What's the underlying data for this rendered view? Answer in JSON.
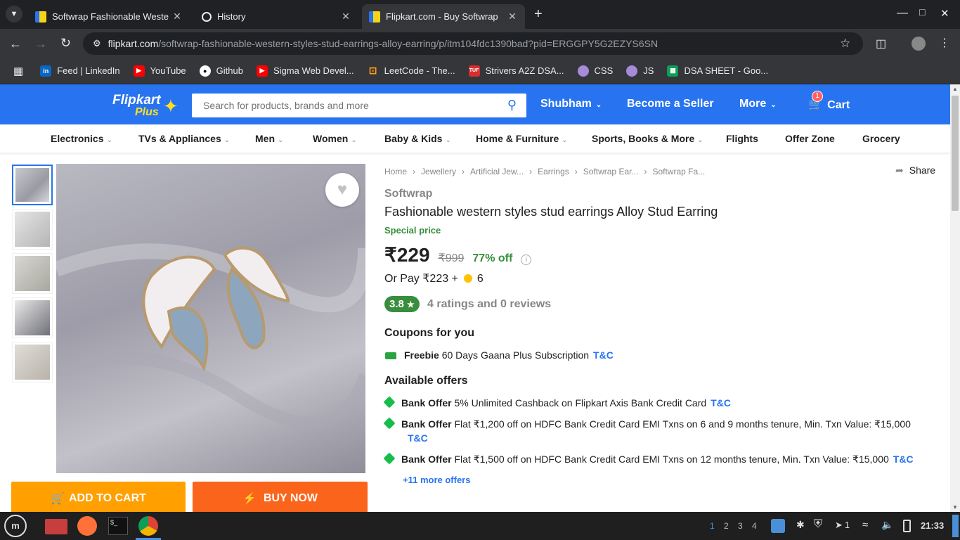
{
  "browser": {
    "tabs": [
      {
        "title": "Softwrap Fashionable Weste"
      },
      {
        "title": "History"
      },
      {
        "title": "Flipkart.com - Buy Softwrap"
      }
    ],
    "url_domain": "flipkart.com",
    "url_path": "/softwrap-fashionable-western-styles-stud-earrings-alloy-earring/p/itm104fdc1390bad?pid=ERGGPY5G2EZYS6SN",
    "bookmarks": [
      "Feed | LinkedIn",
      "YouTube",
      "Github",
      "Sigma Web Devel...",
      "LeetCode - The...",
      "Strivers A2Z DSA...",
      "CSS",
      "JS",
      "DSA SHEET - Goo..."
    ]
  },
  "header": {
    "logo_text": "Flipkart",
    "logo_sub": "Plus",
    "search_placeholder": "Search for products, brands and more",
    "user": "Shubham",
    "seller": "Become a Seller",
    "more": "More",
    "cart": "Cart",
    "cart_count": "1"
  },
  "categories": [
    "Electronics",
    "TVs & Appliances",
    "Men",
    "Women",
    "Baby & Kids",
    "Home & Furniture",
    "Sports, Books & More",
    "Flights",
    "Offer Zone",
    "Grocery"
  ],
  "breadcrumb": [
    "Home",
    "Jewellery",
    "Artificial Jew...",
    "Earrings",
    "Softwrap Ear...",
    "Softwrap Fa..."
  ],
  "share": "Share",
  "product": {
    "brand": "Softwrap",
    "title": "Fashionable western styles stud earrings Alloy Stud Earring",
    "special": "Special price",
    "price": "₹229",
    "mrp": "₹999",
    "discount": "77% off",
    "or_pay": "Or Pay ₹223 +",
    "coins": "6",
    "rating": "3.8",
    "rating_text": "4 ratings and 0 reviews"
  },
  "coupons": {
    "heading": "Coupons for you",
    "label": "Freebie",
    "text": "60 Days Gaana Plus Subscription",
    "tc": "T&C"
  },
  "offers": {
    "heading": "Available offers",
    "items": [
      {
        "label": "Bank Offer",
        "text": "5% Unlimited Cashback on Flipkart Axis Bank Credit Card",
        "tc": "T&C"
      },
      {
        "label": "Bank Offer",
        "text": "Flat ₹1,200 off on HDFC Bank Credit Card EMI Txns on 6 and 9 months tenure, Min. Txn Value: ₹15,000",
        "tc": "T&C"
      },
      {
        "label": "Bank Offer",
        "text": "Flat ₹1,500 off on HDFC Bank Credit Card EMI Txns on 12 months tenure, Min. Txn Value: ₹15,000",
        "tc": "T&C"
      }
    ],
    "more": "+11 more offers"
  },
  "buttons": {
    "add_to_cart": "ADD TO CART",
    "buy_now": "BUY NOW"
  },
  "taskbar": {
    "workspaces": [
      "1",
      "2",
      "3",
      "4"
    ],
    "notif_count": "1",
    "clock": "21:33"
  },
  "colors": {
    "fk_blue": "#2874f0",
    "fk_yellow": "#ff9f00",
    "fk_orange": "#fb641b",
    "fk_green": "#388e3c"
  }
}
